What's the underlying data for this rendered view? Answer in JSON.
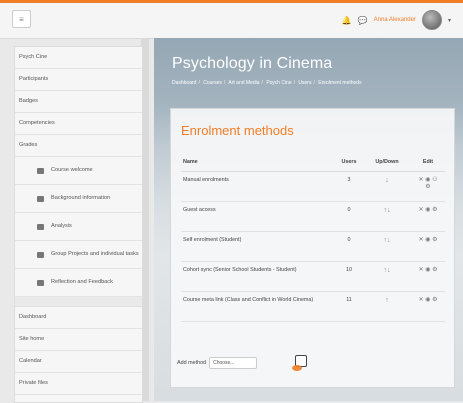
{
  "header": {
    "menu_icon": "hamburger-icon",
    "bell_icon": "bell-icon",
    "chat_icon": "chat-icon",
    "user_name": "Anna Alexander",
    "avatar_icon": "avatar-icon"
  },
  "sidebar": {
    "items_top": [
      {
        "label": "Psych Cine"
      },
      {
        "label": "Participants"
      },
      {
        "label": "Badges"
      },
      {
        "label": "Competencies"
      },
      {
        "label": "Grades"
      }
    ],
    "sections": [
      {
        "label": "Course welcome"
      },
      {
        "label": "Background information"
      },
      {
        "label": "Analysis"
      },
      {
        "label": "Group Projects and individual tasks"
      },
      {
        "label": "Reflection and Feedback"
      }
    ],
    "items_bottom": [
      {
        "label": "Dashboard"
      },
      {
        "label": "Site home"
      },
      {
        "label": "Calendar"
      },
      {
        "label": "Private files"
      }
    ]
  },
  "hero": {
    "title": "Psychology in Cinema",
    "breadcrumb": [
      "Dashboard",
      "Courses",
      "Art and Media",
      "Psych Cine",
      "Users",
      "Enrolment methods"
    ]
  },
  "card": {
    "title": "Enrolment methods",
    "columns": [
      "Name",
      "Users",
      "Up/Down",
      "Edit"
    ],
    "rows": [
      {
        "name": "Manual enrolments",
        "users": "3",
        "updown": "↓",
        "edit": "✕ ◉ ⚇ ⚙"
      },
      {
        "name": "Guest access",
        "users": "0",
        "updown": "↑↓",
        "edit": "✕ ◉ ⚙"
      },
      {
        "name": "Self enrolment (Student)",
        "users": "0",
        "updown": "↑↓",
        "edit": "✕ ◉ ⚙"
      },
      {
        "name": "Cohort sync (Senior School Students - Student)",
        "users": "10",
        "updown": "↑↓",
        "edit": "✕ ◉ ⚙"
      },
      {
        "name": "Course meta link (Class and Conflict in World Cinema)",
        "users": "11",
        "updown": "↑",
        "edit": "✕ ◉ ⚙"
      }
    ],
    "add_method_label": "Add method",
    "add_method_select_value": "Choose..."
  }
}
